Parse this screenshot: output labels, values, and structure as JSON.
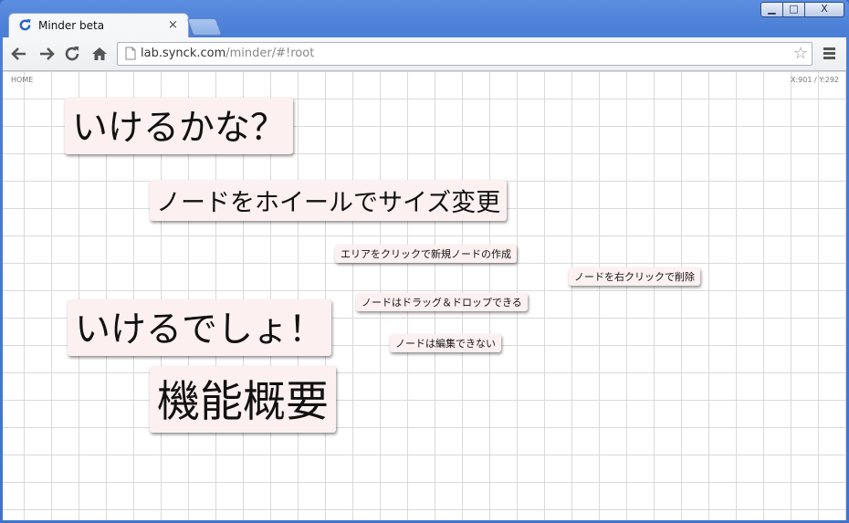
{
  "browser": {
    "tab_title": "Minder beta",
    "tab_close": "×",
    "url_host": "lab.synck.com",
    "url_path": "/minder/#!root",
    "window_controls": {
      "minimize": "▁",
      "maximize": "□",
      "close": "X"
    },
    "icons": [
      "chrome-reload-favicon",
      "back-icon",
      "forward-icon",
      "reload-icon",
      "home-icon",
      "page-icon",
      "star-icon",
      "menu-icon"
    ]
  },
  "canvas": {
    "home_label": "HOME",
    "coords": "X:901 / Y:292",
    "nodes": [
      {
        "text": "いけるかな？"
      },
      {
        "text": "ノードをホイールでサイズ変更"
      },
      {
        "text": "エリアをクリックで新規ノードの作成"
      },
      {
        "text": "ノードを右クリックで削除"
      },
      {
        "text": "ノードはドラッグ＆ドロップできる"
      },
      {
        "text": "いけるでしょ！"
      },
      {
        "text": "ノードは編集できない"
      },
      {
        "text": "機能概要"
      }
    ]
  },
  "colors": {
    "node_bg": "#fdf0f0",
    "frame": "#3f74cc",
    "grid": "#d9d9d9"
  }
}
